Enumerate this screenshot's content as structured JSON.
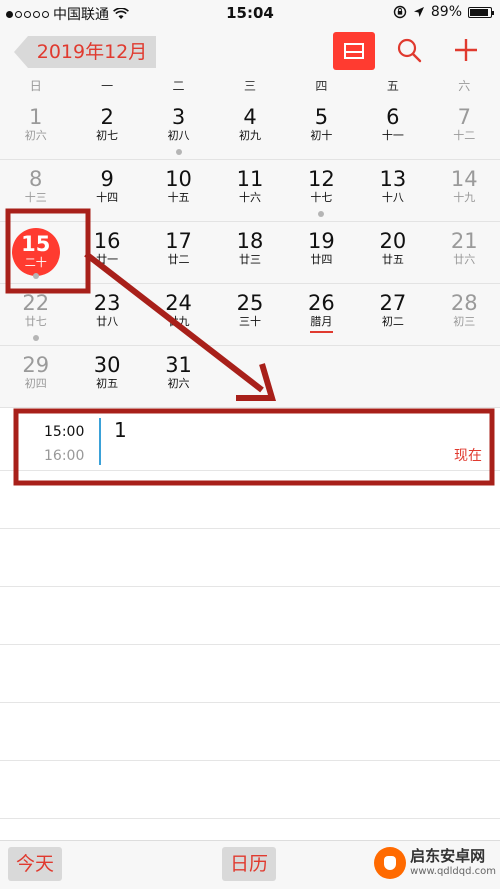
{
  "status_bar": {
    "carrier": "中国联通",
    "time": "15:04",
    "battery": "89%",
    "battery_level": 0.89
  },
  "nav": {
    "back_label": "2019年12月"
  },
  "weekdays": [
    "日",
    "一",
    "二",
    "三",
    "四",
    "五",
    "六"
  ],
  "weeks": [
    [
      {
        "day": "1",
        "lunar": "初六",
        "weekend": true,
        "dot": false
      },
      {
        "day": "2",
        "lunar": "初七",
        "weekend": false,
        "dot": false
      },
      {
        "day": "3",
        "lunar": "初八",
        "weekend": false,
        "dot": true
      },
      {
        "day": "4",
        "lunar": "初九",
        "weekend": false,
        "dot": false
      },
      {
        "day": "5",
        "lunar": "初十",
        "weekend": false,
        "dot": false
      },
      {
        "day": "6",
        "lunar": "十一",
        "weekend": false,
        "dot": false
      },
      {
        "day": "7",
        "lunar": "十二",
        "weekend": true,
        "dot": false
      }
    ],
    [
      {
        "day": "8",
        "lunar": "十三",
        "weekend": true,
        "dot": false
      },
      {
        "day": "9",
        "lunar": "十四",
        "weekend": false,
        "dot": false
      },
      {
        "day": "10",
        "lunar": "十五",
        "weekend": false,
        "dot": false
      },
      {
        "day": "11",
        "lunar": "十六",
        "weekend": false,
        "dot": false
      },
      {
        "day": "12",
        "lunar": "十七",
        "weekend": false,
        "dot": true
      },
      {
        "day": "13",
        "lunar": "十八",
        "weekend": false,
        "dot": false
      },
      {
        "day": "14",
        "lunar": "十九",
        "weekend": true,
        "dot": false
      }
    ],
    [
      {
        "day": "15",
        "lunar": "二十",
        "weekend": true,
        "dot": true,
        "today": true
      },
      {
        "day": "16",
        "lunar": "廿一",
        "weekend": false,
        "dot": false
      },
      {
        "day": "17",
        "lunar": "廿二",
        "weekend": false,
        "dot": false
      },
      {
        "day": "18",
        "lunar": "廿三",
        "weekend": false,
        "dot": false
      },
      {
        "day": "19",
        "lunar": "廿四",
        "weekend": false,
        "dot": false
      },
      {
        "day": "20",
        "lunar": "廿五",
        "weekend": false,
        "dot": false
      },
      {
        "day": "21",
        "lunar": "廿六",
        "weekend": true,
        "dot": false
      }
    ],
    [
      {
        "day": "22",
        "lunar": "廿七",
        "weekend": true,
        "dot": true
      },
      {
        "day": "23",
        "lunar": "廿八",
        "weekend": false,
        "dot": false
      },
      {
        "day": "24",
        "lunar": "廿九",
        "weekend": false,
        "dot": false
      },
      {
        "day": "25",
        "lunar": "三十",
        "weekend": false,
        "dot": false
      },
      {
        "day": "26",
        "lunar": "腊月",
        "weekend": false,
        "dot": false,
        "month_start": true
      },
      {
        "day": "27",
        "lunar": "初二",
        "weekend": false,
        "dot": false
      },
      {
        "day": "28",
        "lunar": "初三",
        "weekend": true,
        "dot": false
      }
    ],
    [
      {
        "day": "29",
        "lunar": "初四",
        "weekend": true,
        "dot": false
      },
      {
        "day": "30",
        "lunar": "初五",
        "weekend": false,
        "dot": false
      },
      {
        "day": "31",
        "lunar": "初六",
        "weekend": false,
        "dot": false
      }
    ]
  ],
  "event": {
    "start": "15:00",
    "end": "16:00",
    "title": "1",
    "now_label": "现在"
  },
  "toolbar": {
    "today_label": "今天",
    "calendars_label": "日历"
  },
  "watermark": {
    "name": "启东安卓网",
    "url": "www.qdldqd.com"
  },
  "colors": {
    "accent": "#e03a2f",
    "today": "#ff3b30",
    "event_bar": "#3aa1d8",
    "annotation": "#a8201a"
  }
}
